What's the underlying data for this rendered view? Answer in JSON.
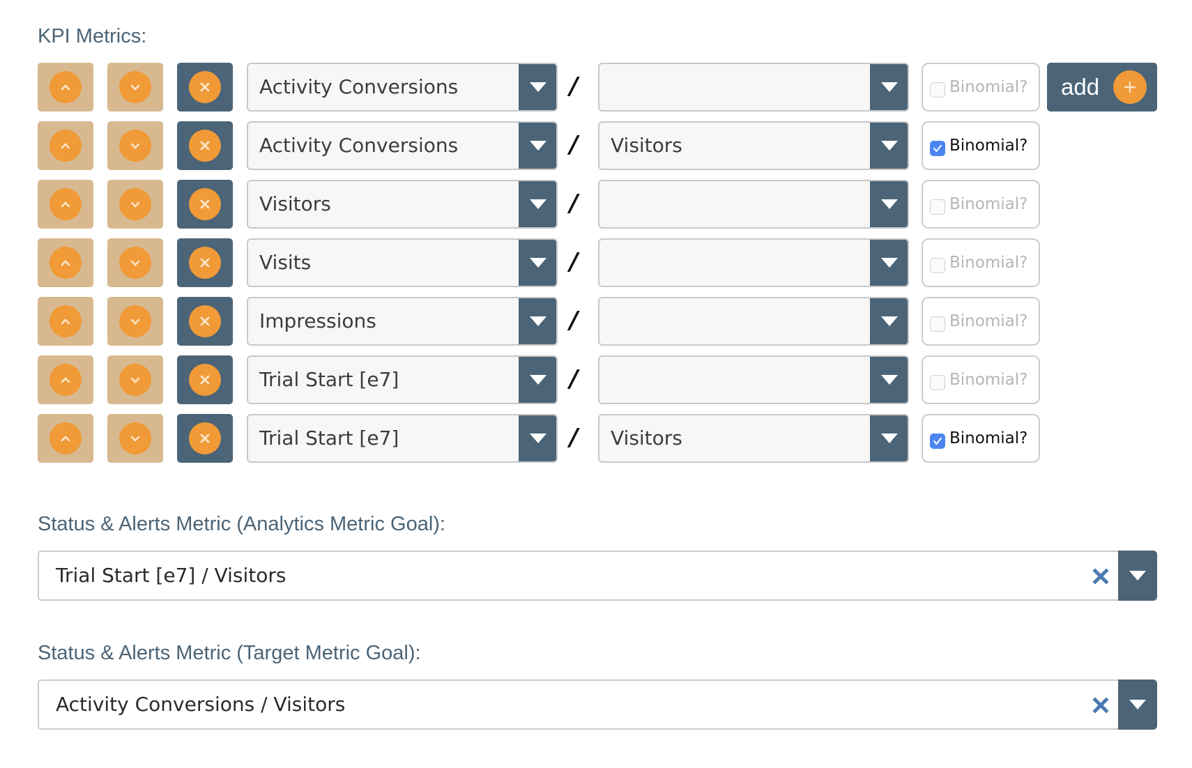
{
  "kpi": {
    "heading": "KPI Metrics:",
    "add_label": "add",
    "binomial_label": "Binomial?",
    "slash": "/",
    "rows": [
      {
        "numerator": "Activity Conversions",
        "denominator": "",
        "binomial": false
      },
      {
        "numerator": "Activity Conversions",
        "denominator": "Visitors",
        "binomial": true
      },
      {
        "numerator": "Visitors",
        "denominator": "",
        "binomial": false
      },
      {
        "numerator": "Visits",
        "denominator": "",
        "binomial": false
      },
      {
        "numerator": "Impressions",
        "denominator": "",
        "binomial": false
      },
      {
        "numerator": "Trial Start [e7]",
        "denominator": "",
        "binomial": false
      },
      {
        "numerator": "Trial Start [e7]",
        "denominator": "Visitors",
        "binomial": true
      }
    ]
  },
  "analytics_goal": {
    "heading": "Status & Alerts Metric (Analytics Metric Goal):",
    "value": "Trial Start [e7] / Visitors"
  },
  "target_goal": {
    "heading": "Status & Alerts Metric (Target Metric Goal):",
    "value": "Activity Conversions / Visitors"
  },
  "colors": {
    "accent_orange": "#f09a38",
    "tan": "#d8b98f",
    "slate": "#4b6477",
    "checkbox_blue": "#4c85f2",
    "clear_blue": "#4a7ab0"
  }
}
